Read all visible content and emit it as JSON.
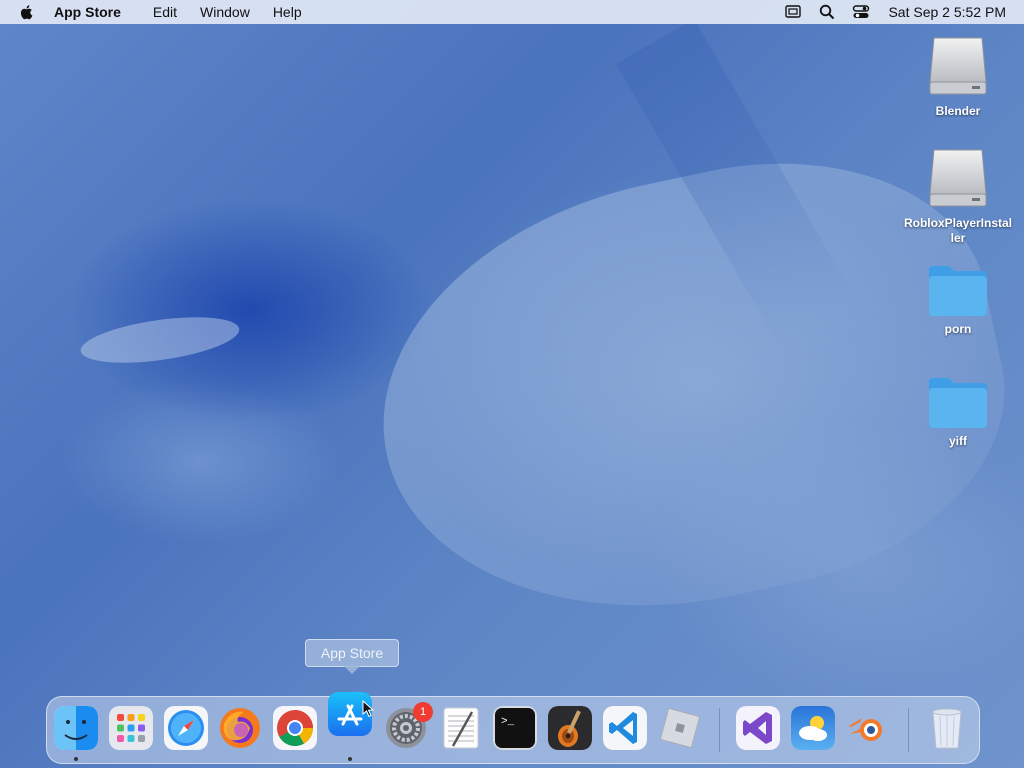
{
  "menubar": {
    "app_name": "App Store",
    "items": [
      "Edit",
      "Window",
      "Help"
    ],
    "clock": "Sat Sep 2  5:52 PM"
  },
  "desktop_items": [
    {
      "label": "Blender",
      "kind": "drive"
    },
    {
      "label": "RobloxPlayerInstal\nler",
      "kind": "drive"
    },
    {
      "label": "porn",
      "kind": "folder"
    },
    {
      "label": "yiff",
      "kind": "folder"
    }
  ],
  "tooltip": {
    "text": "App Store"
  },
  "dock": {
    "apps": [
      "Finder",
      "Launchpad",
      "Safari",
      "Firefox",
      "Google Chrome",
      "App Store",
      "System Settings",
      "TextEdit",
      "Terminal",
      "GarageBand",
      "Visual Studio Code",
      "Roblox",
      "Visual Studio",
      "Weather",
      "Blender",
      "Trash"
    ],
    "badge": "1"
  },
  "colors": {
    "accent": "#1a73e8",
    "badge": "#f03b33",
    "folder": "#5ab4f0"
  }
}
